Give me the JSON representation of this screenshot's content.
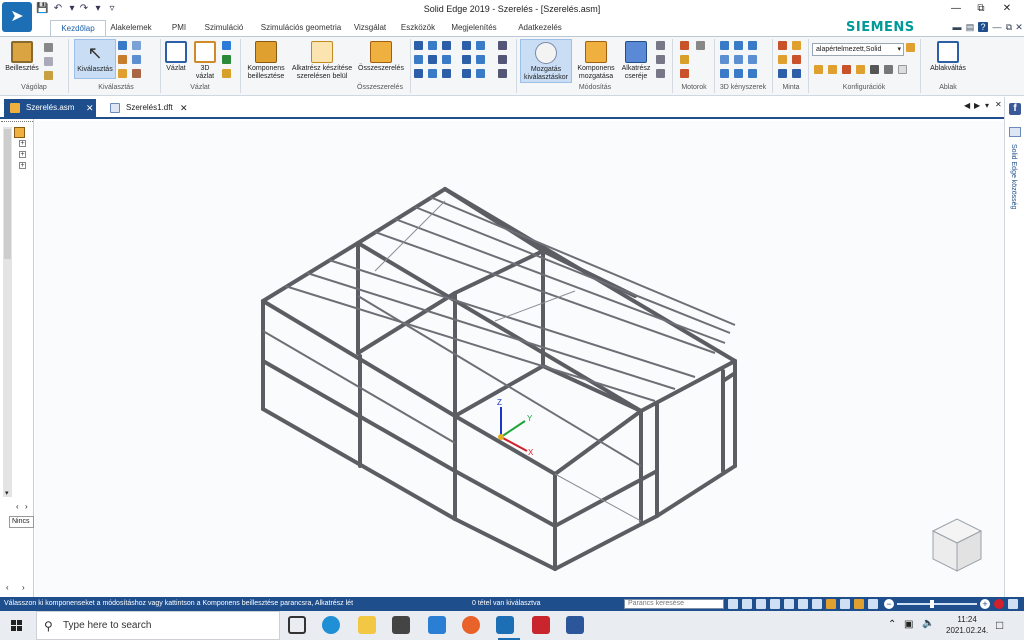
{
  "window": {
    "title": "Solid Edge 2019 - Szerelés - [Szerelés.asm]"
  },
  "ribbon_tabs": [
    "Kezdőlap",
    "Alakelemek",
    "PMI",
    "Szimuláció",
    "Szimulációs geometria",
    "Vizsgálat",
    "Eszközök",
    "Megjelenítés",
    "Adatkezelés"
  ],
  "brand": "SIEMENS",
  "ribbon": {
    "groups": {
      "vagolap": "Vágólap",
      "kivalasztas": "Kiválasztás",
      "vazlat": "Vázlat",
      "osszeszereles": "Összeszerelés",
      "modositas": "Módosítás",
      "motorok": "Motorok",
      "kenyszerek": "3D kényszerek",
      "minta": "Minta",
      "konfiguraciok": "Konfigurációk",
      "ablak": "Ablak"
    },
    "buttons": {
      "beillesztes": "Beillesztés",
      "kivalasztas": "Kiválasztás",
      "vazlat": "Vázlat",
      "vazlat3d_l1": "3D",
      "vazlat3d_l2": "vázlat",
      "komponens_l1": "Komponens",
      "komponens_l2": "beillesztése",
      "alkatresz_l1": "Alkatrész készítése",
      "alkatresz_l2": "szerelésen belül",
      "osszeszereles": "Összeszerelés",
      "mozgatas_l1": "Mozgatás",
      "mozgatas_l2": "kiválasztáskor",
      "kompmozg_l1": "Komponens",
      "kompmozg_l2": "mozgatása",
      "csere_l1": "Alkatrész",
      "csere_l2": "cseréje",
      "ablakvaltas": "Ablakváltás"
    },
    "config_value": "alapértelmezett,Solid"
  },
  "doc_tabs": [
    {
      "label": "Szerelés.asm",
      "active": true
    },
    {
      "label": "Szerelés1.dft",
      "active": false
    }
  ],
  "left_pane": {
    "nincs": "Nincs"
  },
  "right_bar": {
    "label": "Solid Edge közösség"
  },
  "status": {
    "prompt": "Válasszon ki komponenseket a módosításhoz vagy kattintson a Komponens beillesztése parancsra, Alkatrész lét",
    "selection": "0 tétel van kiválasztva",
    "search_placeholder": "Parancs keresése"
  },
  "taskbar": {
    "search_placeholder": "Type here to search",
    "time": "11:24",
    "date": "2021.02.24."
  },
  "colors": {
    "accent": "#1e4e8c",
    "brand": "#009999",
    "frame": "#5a5e63"
  }
}
